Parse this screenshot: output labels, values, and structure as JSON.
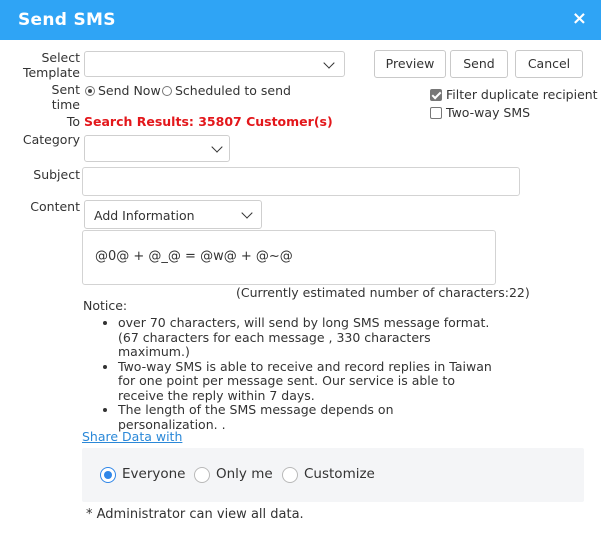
{
  "dialog": {
    "title": "Send SMS",
    "close_symbol": "×"
  },
  "labels": {
    "select_template_1": "Select",
    "select_template_2": "Template",
    "sent_time_1": "Sent",
    "sent_time_2": "time",
    "to": "To",
    "category": "Category",
    "subject": "Subject",
    "content": "Content"
  },
  "buttons": {
    "preview": "Preview",
    "send": "Send",
    "cancel": "Cancel"
  },
  "sent_time": {
    "options": [
      "Send Now",
      "Scheduled to send"
    ],
    "selected": "Send Now"
  },
  "options": {
    "filter_duplicate": "Filter duplicate recipient",
    "filter_duplicate_checked": true,
    "two_way": "Two-way SMS",
    "two_way_checked": false
  },
  "to": {
    "search_results": "Search Results: 35807 Customer(s)"
  },
  "template_select": {
    "value": ""
  },
  "category_select": {
    "value": ""
  },
  "subject": {
    "value": ""
  },
  "content": {
    "add_information": "Add Information",
    "message": "@0@ + @_@ = @w@ + @~@",
    "char_count": "(Currently estimated number of characters:22)"
  },
  "notice": {
    "title": "Notice:",
    "items": [
      "over 70 characters, will send by long SMS message format. (67 characters for each message , 330 characters maximum.)",
      "Two-way SMS is able to receive and record replies in Taiwan for one point per message sent. Our service is able to receive the reply within 7 days.",
      "The length of the SMS message depends on personalization. ."
    ]
  },
  "share": {
    "link": "Share Data with",
    "options": [
      "Everyone",
      "Only me",
      "Customize"
    ],
    "selected": "Everyone",
    "footnote": "*  Administrator can view all data."
  },
  "colors": {
    "titlebar": "#2fa4f5",
    "alert": "#e3171b",
    "link": "#2a88d8",
    "radio_selected": "#2f86e8"
  }
}
